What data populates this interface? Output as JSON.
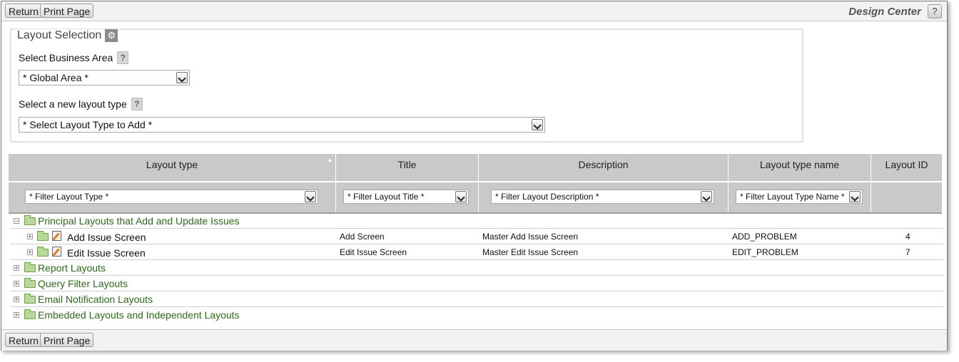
{
  "toolbar": {
    "return_label": "Return",
    "print_label": "Print Page",
    "app_title": "Design Center",
    "help_label": "?"
  },
  "layout_selection": {
    "legend": "Layout Selection",
    "business_area_label": "Select Business Area",
    "business_area_value": "* Global Area *",
    "layout_type_label": "Select a new layout type",
    "layout_type_value": "* Select Layout Type to Add *",
    "help_label": "?"
  },
  "table": {
    "columns": [
      "Layout type",
      "Title",
      "Description",
      "Layout type name",
      "Layout ID"
    ],
    "filters": [
      "* Filter Layout Type *",
      "* Filter Layout Title *",
      "* Filter Layout Description *",
      "* Filter Layout Type Name *"
    ]
  },
  "tree": {
    "groups": [
      {
        "label": "Principal Layouts that Add and Update Issues",
        "expanded": true,
        "children": [
          {
            "name": "Add Issue Screen",
            "title": "Add Screen",
            "description": "Master Add Issue Screen",
            "type_name": "ADD_PROBLEM",
            "id": "4"
          },
          {
            "name": "Edit Issue Screen",
            "title": "Edit Issue Screen",
            "description": "Master Edit Issue Screen",
            "type_name": "EDIT_PROBLEM",
            "id": "7"
          }
        ]
      },
      {
        "label": "Report Layouts",
        "expanded": false
      },
      {
        "label": "Query Filter Layouts",
        "expanded": false
      },
      {
        "label": "Email Notification Layouts",
        "expanded": false
      },
      {
        "label": "Embedded Layouts and Independent Layouts",
        "expanded": false
      }
    ],
    "expand_symbol": "+",
    "collapse_symbol": "−"
  },
  "icons": [
    "folder-icon",
    "edit-layout-icon",
    "gear-icon",
    "help-icon",
    "chevron-down-icon"
  ],
  "colors": {
    "group_text": "#2d6a1c",
    "header_bg": "#c9c9c9",
    "bar_bg": "#f2f2f2"
  }
}
